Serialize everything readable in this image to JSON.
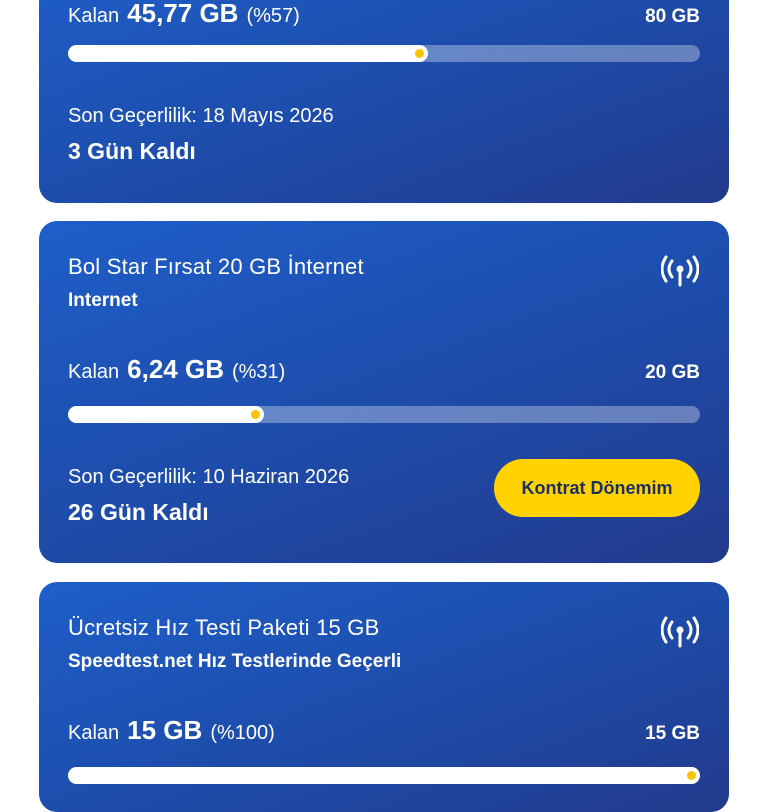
{
  "cards": [
    {
      "remaining_label": "Kalan",
      "remaining_value": "45,77 GB",
      "remaining_percent": "(%57)",
      "total": "80 GB",
      "progress_percent": 57,
      "validity": "Son Geçerlilik: 18 Mayıs 2026",
      "days_left": "3 Gün Kaldı"
    },
    {
      "title": "Bol Star Fırsat 20 GB İnternet",
      "subtitle": "Internet",
      "remaining_label": "Kalan",
      "remaining_value": "6,24 GB",
      "remaining_percent": "(%31)",
      "total": "20 GB",
      "progress_percent": 31,
      "validity": "Son Geçerlilik: 10 Haziran 2026",
      "days_left": "26 Gün Kaldı",
      "button_label": "Kontrat Dönemim"
    },
    {
      "title": "Ücretsiz Hız Testi Paketi 15 GB",
      "subtitle": "Speedtest.net Hız Testlerinde Geçerli",
      "remaining_label": "Kalan",
      "remaining_value": "15 GB",
      "remaining_percent": "(%100)",
      "total": "15 GB",
      "progress_percent": 100
    }
  ],
  "icons": {
    "signal": "signal-antenna-icon"
  },
  "colors": {
    "card_gradient_start": "#1f5ec9",
    "card_gradient_end": "#223a8c",
    "accent_yellow": "#ffd200",
    "progress_dot": "#f6c400"
  }
}
